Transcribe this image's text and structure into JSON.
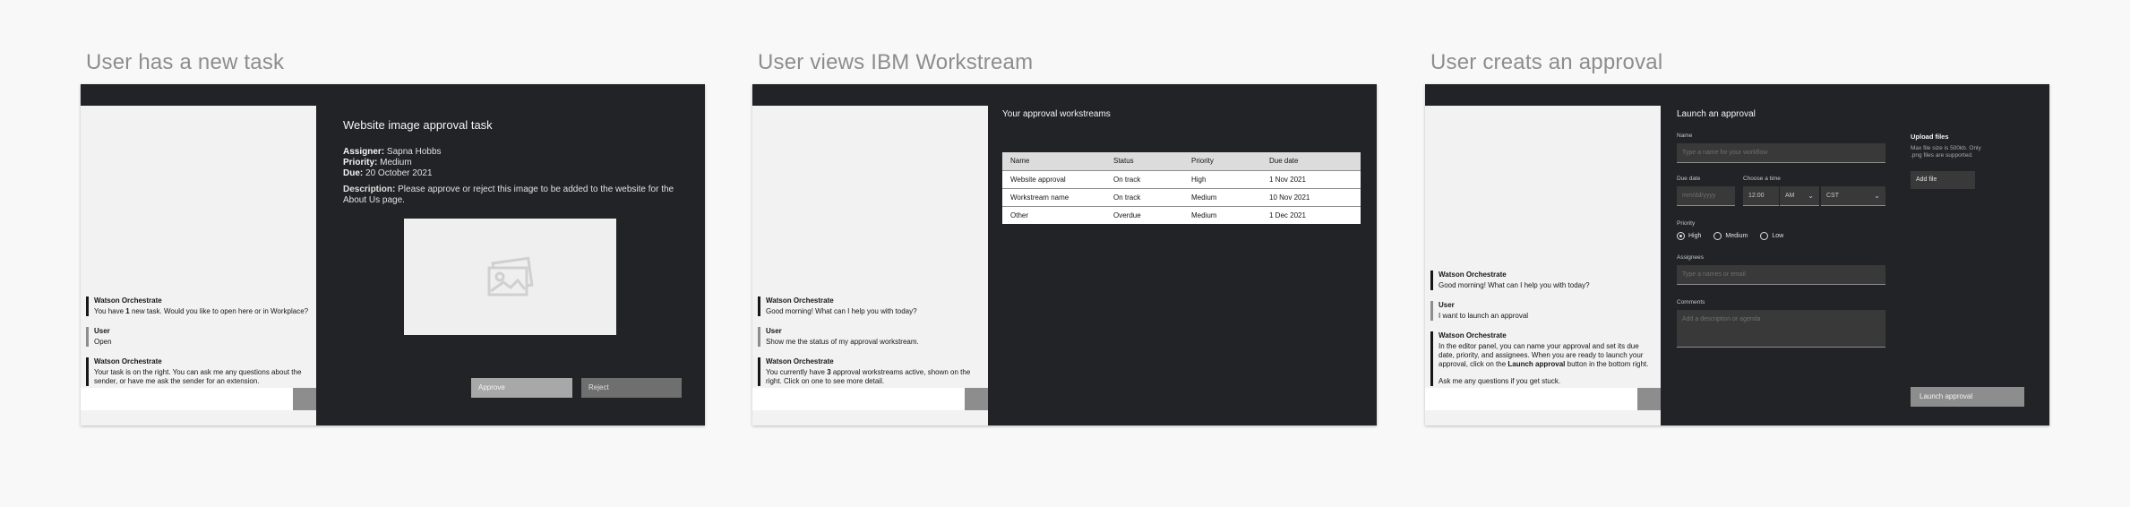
{
  "panels": [
    {
      "heading": "User has a new task",
      "chat": [
        {
          "who": "Watson Orchestrate",
          "pre": "You have ",
          "bold": "1",
          "post": " new task. Would you like to open here or in Workplace?"
        },
        {
          "who": "User",
          "text": "Open"
        },
        {
          "who": "Watson Orchestrate",
          "text": "Your task is on the right. You can ask me any questions about the sender, or have me ask the sender for an extension."
        }
      ],
      "task": {
        "title": "Website image approval task",
        "assigner_label": "Assigner:",
        "assigner": "Sapna Hobbs",
        "priority_label": "Priority:",
        "priority": "Medium",
        "due_label": "Due:",
        "due": "20 October 2021",
        "desc_label": "Description:",
        "desc": "Please approve or reject this image to be added to the website for the About Us page.",
        "approve": "Approve",
        "reject": "Reject",
        "image_icon": "image-placeholder-icon"
      }
    },
    {
      "heading": "User views IBM Workstream",
      "chat": [
        {
          "who": "Watson Orchestrate",
          "text": "Good morning! What can I help you with today?"
        },
        {
          "who": "User",
          "text": "Show me the status of my approval workstream."
        },
        {
          "who": "Watson Orchestrate",
          "pre": "You currently have ",
          "bold": "3",
          "post": " approval workstreams active, shown on the right. Click on one to see more detail."
        }
      ],
      "workstreams": {
        "title": "Your approval workstreams",
        "columns": [
          "Name",
          "Status",
          "Priority",
          "Due date"
        ],
        "rows": [
          [
            "Website approval",
            "On track",
            "High",
            "1 Nov 2021"
          ],
          [
            "Workstream name",
            "On track",
            "Medium",
            "10 Nov 2021"
          ],
          [
            "Other",
            "Overdue",
            "Medium",
            "1 Dec 2021"
          ]
        ]
      }
    },
    {
      "heading": "User creats an approval",
      "chat": [
        {
          "who": "Watson Orchestrate",
          "text": "Good morning! What can I help you with today?"
        },
        {
          "who": "User",
          "text": "I want to launch an approval"
        },
        {
          "who": "Watson Orchestrate",
          "pre": "In the editor panel, you can name your approval and set its due date, priority, and assignees. When you are ready to launch your approval, click on the ",
          "bold": "Launch approval",
          "post": " button in the bottom right.",
          "extra": "Ask me any questions if you get stuck."
        }
      ],
      "form": {
        "title": "Launch an approval",
        "name_label": "Name",
        "name_placeholder": "Type a name for your workflow",
        "due_label": "Due date",
        "due_placeholder": "mm/dd/yyyy",
        "time_label": "Choose a time",
        "time_value": "12:00",
        "ampm": "AM",
        "tz": "CST",
        "priority_label": "Priority",
        "priorities": [
          "High",
          "Medium",
          "Low"
        ],
        "assignees_label": "Assignees",
        "assignees_placeholder": "Type a names or email",
        "comments_label": "Comments",
        "comments_placeholder": "Add a description or agenda",
        "upload_title": "Upload files",
        "upload_help": "Max file size is 500kb. Only .png files are supported.",
        "add_file": "Add file",
        "launch": "Launch approval"
      }
    }
  ],
  "colors": {
    "dark": "#212326",
    "chat_bg": "#f2f2f2",
    "page_bg": "#f8f8f8"
  }
}
